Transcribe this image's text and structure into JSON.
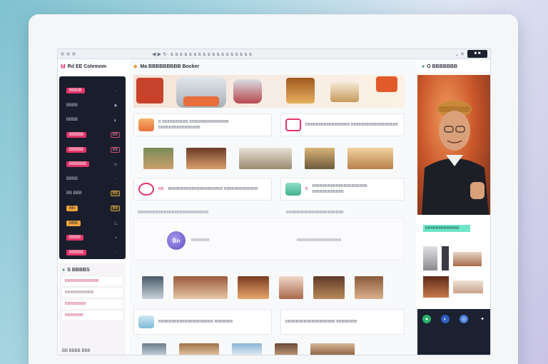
{
  "browser": {
    "url": "s s s s s  s s s s s s  s s s s s s s",
    "left_ui": "◀ ▶ ↻",
    "right_ui": "⌄ ✕"
  },
  "sidebar": {
    "brand_logo": "M",
    "brand_name": "Rd EE Colemom",
    "items": [
      {
        "label": "BBBIB",
        "style": "pill",
        "icon": "·"
      },
      {
        "label": "BBBB",
        "style": "plain",
        "icon": "●"
      },
      {
        "label": "BBBB",
        "style": "plain",
        "icon": "◐"
      },
      {
        "label": "BBBBB",
        "style": "pill",
        "icon": "BB"
      },
      {
        "label": "BBBBB",
        "style": "pill",
        "icon": "BB"
      },
      {
        "label": "BBBBBB",
        "style": "pill",
        "icon": "≈"
      },
      {
        "label": "BBBB",
        "style": "plain",
        "icon": "·"
      },
      {
        "label": "BB BBB",
        "style": "plain",
        "icon": "BB"
      },
      {
        "label": "BB",
        "style": "orange",
        "icon": "BB"
      },
      {
        "label": "BBB",
        "style": "orange",
        "icon": "⌂"
      },
      {
        "label": "BBBB",
        "style": "pill",
        "icon": "◔"
      },
      {
        "label": "BBBBB",
        "style": "pill",
        "icon": "·"
      }
    ],
    "section_title": "S BBBBS",
    "section_rows": [
      "BBBBBBBBBBBBB",
      "BBBBBBBBBBB",
      "BBBBBBBB",
      "BBBBBBB"
    ],
    "section_footer": "BB BBBB BBB"
  },
  "main": {
    "title": "Ma BBBBBBBBB Bocker",
    "cards_row1": [
      {
        "text": "B BBBBBBBBBB BBBBBBBBBBBBBBB BBBBBBBBBBBBBBBB",
        "tag": ""
      },
      {
        "text": "BBBBBBBBBBBBBBBBB BBBBBBBBBBBBBBBBBB",
        "tag": ""
      }
    ],
    "cards_row2": [
      {
        "text": "BBBBBBBBBBBBBBBBBBBBB BBBBBBBBBBBBB",
        "tag": "BB"
      },
      {
        "text": "BBBBBBBBBBBBBBBBBBBBB BBBBBBBBBBBB",
        "tag": "B"
      }
    ],
    "info_line_1": "BBBBBBBBBBBBBBBBBBBBBBBBBBB",
    "info_line_2": "BBBBBBBBBBBBBBBBBBBBBB",
    "banner_left": "BBBBBBB",
    "banner_right": "BBBBBBBBBBBBBBBBB",
    "bottom_cards": [
      {
        "text": "BBBBBBBBBBBBBBBBBBBBB BBBBBBB"
      },
      {
        "text": "BBBBBBBBBBBBBBBBBBB BBBBBBBB"
      }
    ]
  },
  "right": {
    "title": "O BBBBBBB",
    "tag": "BBBBBBBBBBBBB"
  },
  "colors": {
    "accent_pink": "#e2356a",
    "sidebar_dark": "#1a1e2c",
    "teal": "#6fe6c9"
  }
}
